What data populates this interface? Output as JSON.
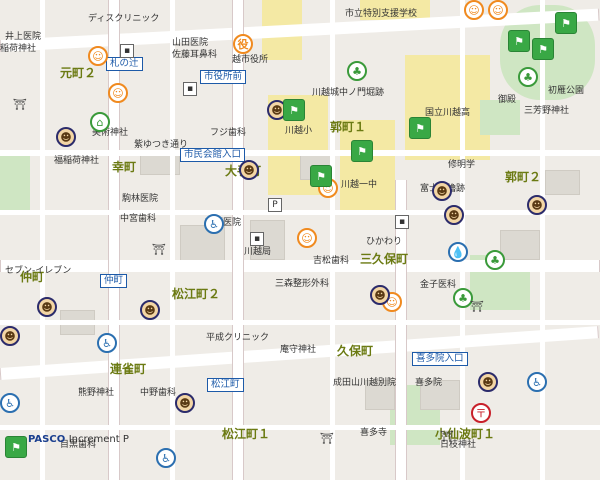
{
  "map": {
    "copyright": {
      "brand": "PASCO",
      "rest": "Increment P"
    },
    "districts": [
      {
        "id": "kurumamachi1",
        "text": "郭町１"
      },
      {
        "id": "kurumamachi2",
        "text": "郭町２"
      },
      {
        "id": "otemachi",
        "text": "大手町"
      },
      {
        "id": "saiwaicho",
        "text": "幸町"
      },
      {
        "id": "sankubocho",
        "text": "三久保町"
      },
      {
        "id": "matsuecho2",
        "text": "松江町２"
      },
      {
        "id": "kubomachi",
        "text": "久保町"
      },
      {
        "id": "renjakucho",
        "text": "連雀町"
      },
      {
        "id": "nakamachi",
        "text": "仲町"
      },
      {
        "id": "matsuecho1",
        "text": "松江町１"
      },
      {
        "id": "kosenbacho1",
        "text": "小仙波町１"
      },
      {
        "id": "motomachi2",
        "text": "元町２"
      }
    ],
    "bus_stops": [
      {
        "id": "fudanotsuji",
        "text": "札の辻"
      },
      {
        "id": "shiyakushomae",
        "text": "市役所前"
      },
      {
        "id": "shiminkaikan",
        "text": "市民会館入口"
      },
      {
        "id": "matsuecho",
        "text": "松江町"
      },
      {
        "id": "kitain",
        "text": "喜多院入口"
      },
      {
        "id": "nakamachi_bus",
        "text": "仲町"
      }
    ],
    "labels": [
      {
        "id": "clinic_top",
        "text": "ディスクリニック"
      },
      {
        "id": "shiritsu",
        "text": "市立特別支援学校"
      },
      {
        "id": "inoue",
        "text": "井上医院"
      },
      {
        "id": "inarijinja",
        "text": "稲荷神社"
      },
      {
        "id": "yamada",
        "text": "山田医院"
      },
      {
        "id": "sato",
        "text": "佐藤耳鼻科"
      },
      {
        "id": "kawagoe_shiyakusho",
        "text": "越市役所"
      },
      {
        "id": "jouka",
        "text": "川越城中ノ門堀跡"
      },
      {
        "id": "kawagoe_hs",
        "text": "国立川越高"
      },
      {
        "id": "onsen",
        "text": "御殿"
      },
      {
        "id": "sanyoshi",
        "text": "三芳野神社"
      },
      {
        "id": "hatsukari",
        "text": "初雁公園"
      },
      {
        "id": "bijutsu",
        "text": "美術神社"
      },
      {
        "id": "fuji_shika",
        "text": "フジ歯科"
      },
      {
        "id": "kawagoe_sho",
        "text": "川越小"
      },
      {
        "id": "kawagoe_ichi",
        "text": "川越一中"
      },
      {
        "id": "shumeikai",
        "text": "修明学"
      },
      {
        "id": "fujimi",
        "text": "富士見櫓跡"
      },
      {
        "id": "inari2",
        "text": "福稲荷神社"
      },
      {
        "id": "tokyo_shika",
        "text": "東野医院"
      },
      {
        "id": "nakano_shika",
        "text": "中宮歯科"
      },
      {
        "id": "kawagoekyoku",
        "text": "川越局"
      },
      {
        "id": "yoshimatsu",
        "text": "吉松歯科"
      },
      {
        "id": "hikawa",
        "text": "ひかわり"
      },
      {
        "id": "sanmori",
        "text": "三森整形外科"
      },
      {
        "id": "kaneko",
        "text": "金子医科"
      },
      {
        "id": "heian",
        "text": "平成クリニック"
      },
      {
        "id": "inokura",
        "text": "庵守神社"
      },
      {
        "id": "naritasan",
        "text": "成田山川越別院"
      },
      {
        "id": "kitain_label",
        "text": "喜多院"
      },
      {
        "id": "kumano",
        "text": "熊野神社"
      },
      {
        "id": "nakano",
        "text": "中野歯科"
      },
      {
        "id": "hikawajinja",
        "text": "日枝神社"
      },
      {
        "id": "kijutsuji",
        "text": "喜多寺"
      },
      {
        "id": "seven",
        "text": "セブン-イレブン"
      },
      {
        "id": "meguro",
        "text": "目黒歯科"
      },
      {
        "id": "tsubamachi",
        "text": "紫ゆつき通り"
      },
      {
        "id": "gomazen",
        "text": "駒林医院"
      }
    ],
    "icons": [
      {
        "id": "school",
        "type": "school"
      },
      {
        "id": "shrine",
        "type": "shrine"
      },
      {
        "id": "museum",
        "type": "museum"
      },
      {
        "id": "water",
        "type": "water"
      }
    ],
    "colors": {
      "accent_orange": "#f08a1f",
      "green": "#39a845",
      "bus_blue": "#1d5aa8",
      "district_olive": "#6b7a12"
    }
  }
}
